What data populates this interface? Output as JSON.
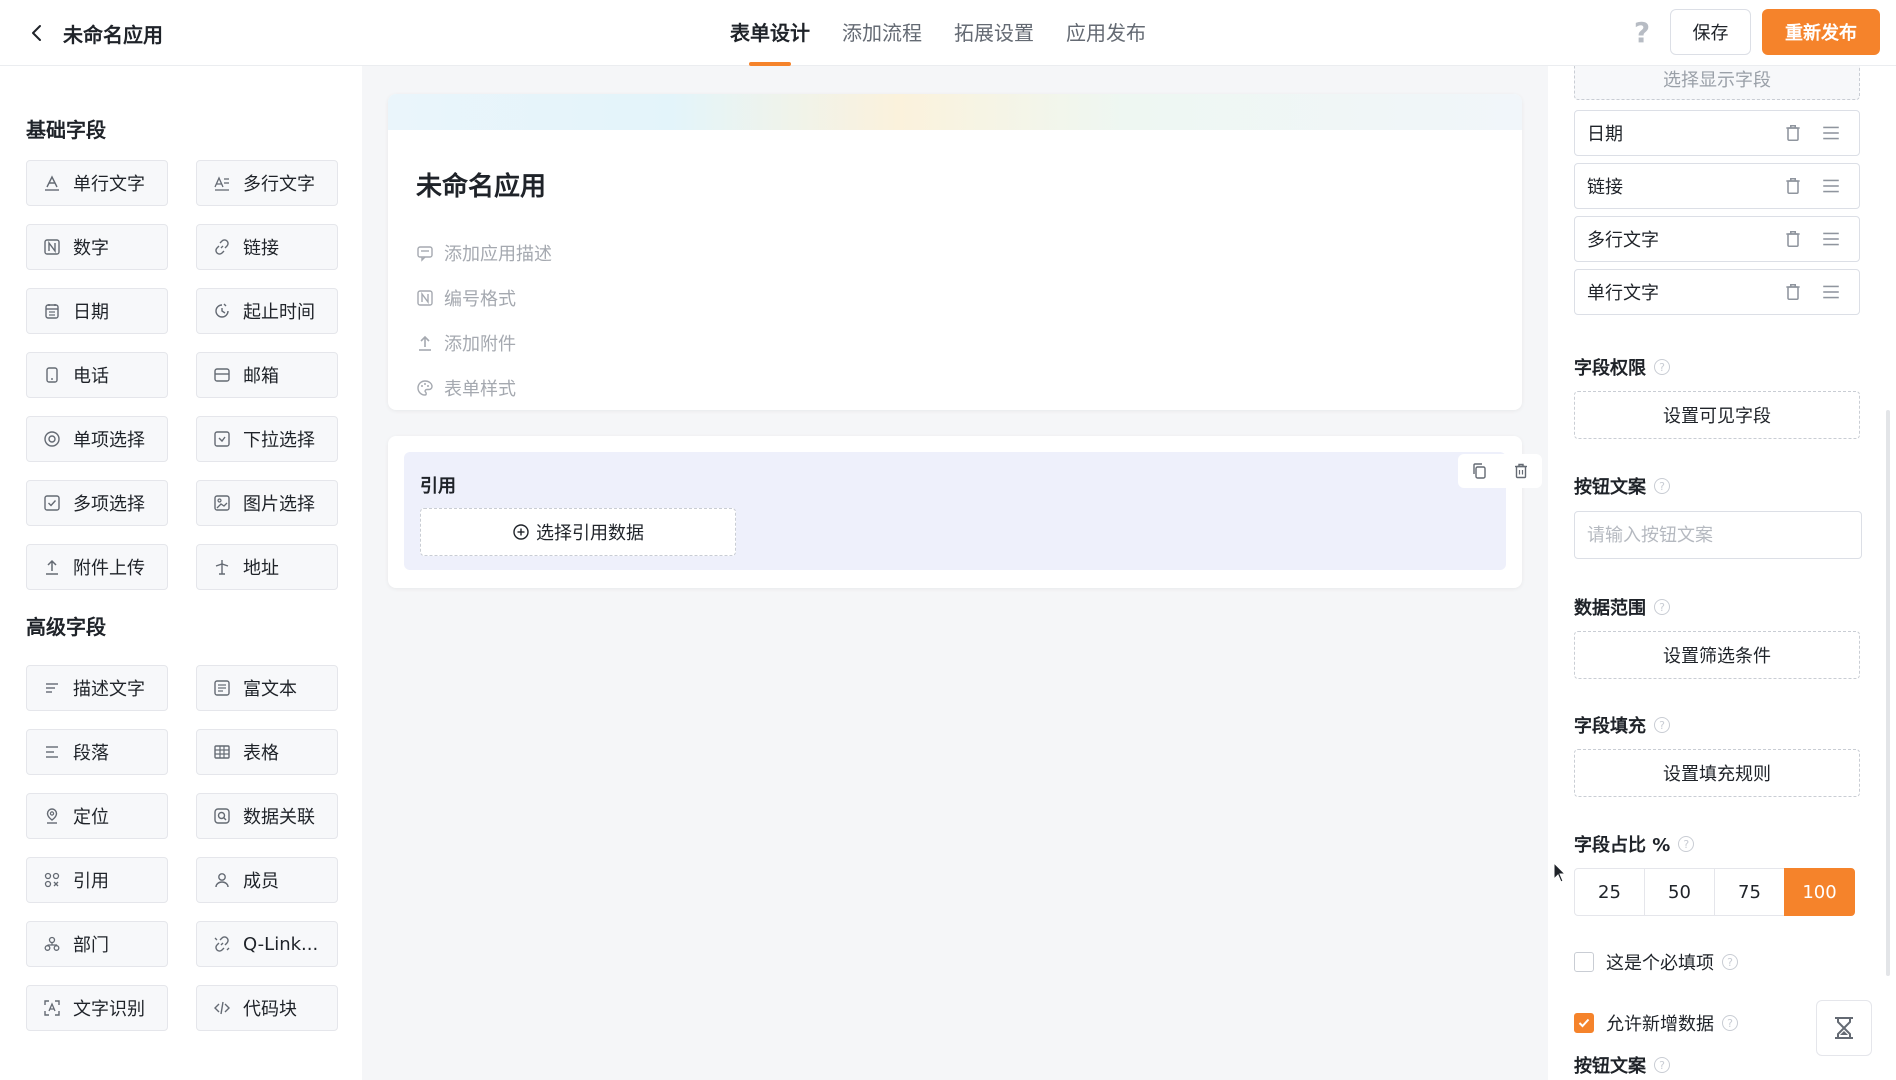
{
  "header": {
    "app_title": "未命名应用",
    "tabs": [
      {
        "label": "表单设计",
        "active": true
      },
      {
        "label": "添加流程",
        "active": false
      },
      {
        "label": "拓展设置",
        "active": false
      },
      {
        "label": "应用发布",
        "active": false
      }
    ],
    "help": "?",
    "save_label": "保存",
    "republish_label": "重新发布"
  },
  "palette": {
    "basic_title": "基础字段",
    "advanced_title": "高级字段",
    "basic": [
      {
        "label": "单行文字",
        "icon": "single-line-text-icon"
      },
      {
        "label": "多行文字",
        "icon": "multi-line-text-icon"
      },
      {
        "label": "数字",
        "icon": "number-icon"
      },
      {
        "label": "链接",
        "icon": "link-icon"
      },
      {
        "label": "日期",
        "icon": "calendar-icon"
      },
      {
        "label": "起止时间",
        "icon": "time-range-icon"
      },
      {
        "label": "电话",
        "icon": "phone-icon"
      },
      {
        "label": "邮箱",
        "icon": "mail-icon"
      },
      {
        "label": "单项选择",
        "icon": "radio-icon"
      },
      {
        "label": "下拉选择",
        "icon": "dropdown-icon"
      },
      {
        "label": "多项选择",
        "icon": "checkbox-icon"
      },
      {
        "label": "图片选择",
        "icon": "image-icon"
      },
      {
        "label": "附件上传",
        "icon": "upload-icon"
      },
      {
        "label": "地址",
        "icon": "address-icon"
      }
    ],
    "advanced": [
      {
        "label": "描述文字",
        "icon": "description-icon"
      },
      {
        "label": "富文本",
        "icon": "rich-text-icon"
      },
      {
        "label": "段落",
        "icon": "paragraph-icon"
      },
      {
        "label": "表格",
        "icon": "table-icon"
      },
      {
        "label": "定位",
        "icon": "location-icon"
      },
      {
        "label": "数据关联",
        "icon": "data-link-icon"
      },
      {
        "label": "引用",
        "icon": "reference-icon"
      },
      {
        "label": "成员",
        "icon": "member-icon"
      },
      {
        "label": "部门",
        "icon": "department-icon"
      },
      {
        "label": "Q-Link...",
        "icon": "qlink-icon"
      },
      {
        "label": "文字识别",
        "icon": "ocr-icon"
      },
      {
        "label": "代码块",
        "icon": "code-icon"
      }
    ]
  },
  "canvas": {
    "form_title": "未命名应用",
    "options": [
      {
        "label": "添加应用描述",
        "icon": "comment-icon"
      },
      {
        "label": "编号格式",
        "icon": "number-format-icon"
      },
      {
        "label": "添加附件",
        "icon": "upload-icon"
      },
      {
        "label": "表单样式",
        "icon": "palette-icon"
      }
    ],
    "reference_field": {
      "label": "引用",
      "select_label": "选择引用数据"
    }
  },
  "props": {
    "select_display_label": "选择显示字段",
    "display_fields": [
      "日期",
      "链接",
      "多行文字",
      "单行文字"
    ],
    "field_permission_label": "字段权限",
    "set_visible_label": "设置可见字段",
    "button_text_label": "按钮文案",
    "button_text_placeholder": "请输入按钮文案",
    "data_range_label": "数据范围",
    "set_filter_label": "设置筛选条件",
    "field_fill_label": "字段填充",
    "set_fill_label": "设置填充规则",
    "field_ratio_label": "字段占比 %",
    "ratio_options": [
      "25",
      "50",
      "75",
      "100"
    ],
    "ratio_selected": "100",
    "required_label": "这是个必填项",
    "required_checked": false,
    "allow_new_label": "允许新增数据",
    "allow_new_checked": true,
    "button_text_label_2": "按钮文案"
  },
  "colors": {
    "accent": "#f5832b",
    "text": "#1f2329",
    "muted": "#a5a9b0"
  }
}
